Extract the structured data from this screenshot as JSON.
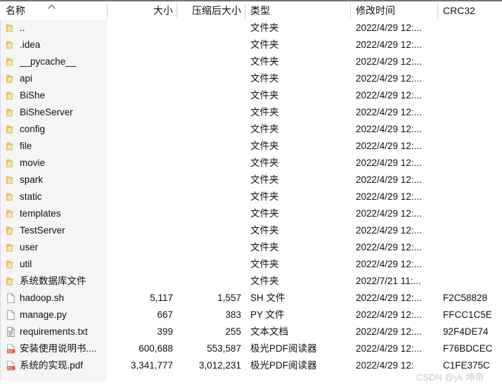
{
  "columns": {
    "name": "名称",
    "size": "大小",
    "packed_size": "压缩后大小",
    "type": "类型",
    "modified": "修改时间",
    "crc32": "CRC32"
  },
  "sort": {
    "column": "名称",
    "direction": "ascending",
    "icon": "chevron-up-icon"
  },
  "watermark": "CSDN @yk 坤帝",
  "accent_colors": {
    "folder": "#f5d07a",
    "folder_dark": "#e8b94d",
    "document": "#ffffff",
    "document_border": "#9a9a9a",
    "pdf_badge": "#e8453c",
    "panel_shade": "#f5f5f5",
    "divider": "#d5d5d5",
    "top_border": "#6b7280"
  },
  "rows": [
    {
      "icon": "folder-icon",
      "name": "..",
      "size": "",
      "packed": "",
      "type": "文件夹",
      "modified": "2022/4/29 12:...",
      "crc": ""
    },
    {
      "icon": "folder-icon",
      "name": ".idea",
      "size": "",
      "packed": "",
      "type": "文件夹",
      "modified": "2022/4/29 12:...",
      "crc": ""
    },
    {
      "icon": "folder-icon",
      "name": "__pycache__",
      "size": "",
      "packed": "",
      "type": "文件夹",
      "modified": "2022/4/29 12:...",
      "crc": ""
    },
    {
      "icon": "folder-icon",
      "name": "api",
      "size": "",
      "packed": "",
      "type": "文件夹",
      "modified": "2022/4/29 12:...",
      "crc": ""
    },
    {
      "icon": "folder-icon",
      "name": "BiShe",
      "size": "",
      "packed": "",
      "type": "文件夹",
      "modified": "2022/4/29 12:...",
      "crc": ""
    },
    {
      "icon": "folder-icon",
      "name": "BiSheServer",
      "size": "",
      "packed": "",
      "type": "文件夹",
      "modified": "2022/4/29 12:...",
      "crc": ""
    },
    {
      "icon": "folder-icon",
      "name": "config",
      "size": "",
      "packed": "",
      "type": "文件夹",
      "modified": "2022/4/29 12:...",
      "crc": ""
    },
    {
      "icon": "folder-icon",
      "name": "file",
      "size": "",
      "packed": "",
      "type": "文件夹",
      "modified": "2022/4/29 12:...",
      "crc": ""
    },
    {
      "icon": "folder-icon",
      "name": "movie",
      "size": "",
      "packed": "",
      "type": "文件夹",
      "modified": "2022/4/29 12:...",
      "crc": ""
    },
    {
      "icon": "folder-icon",
      "name": "spark",
      "size": "",
      "packed": "",
      "type": "文件夹",
      "modified": "2022/4/29 12:...",
      "crc": ""
    },
    {
      "icon": "folder-icon",
      "name": "static",
      "size": "",
      "packed": "",
      "type": "文件夹",
      "modified": "2022/4/29 12:...",
      "crc": ""
    },
    {
      "icon": "folder-icon",
      "name": "templates",
      "size": "",
      "packed": "",
      "type": "文件夹",
      "modified": "2022/4/29 12:...",
      "crc": ""
    },
    {
      "icon": "folder-icon",
      "name": "TestServer",
      "size": "",
      "packed": "",
      "type": "文件夹",
      "modified": "2022/4/29 12:...",
      "crc": ""
    },
    {
      "icon": "folder-icon",
      "name": "user",
      "size": "",
      "packed": "",
      "type": "文件夹",
      "modified": "2022/4/29 12:...",
      "crc": ""
    },
    {
      "icon": "folder-icon",
      "name": "util",
      "size": "",
      "packed": "",
      "type": "文件夹",
      "modified": "2022/4/29 12:...",
      "crc": ""
    },
    {
      "icon": "folder-icon",
      "name": "系统数据库文件",
      "size": "",
      "packed": "",
      "type": "文件夹",
      "modified": "2022/7/21 11:...",
      "crc": ""
    },
    {
      "icon": "file-blank-icon",
      "name": "hadoop.sh",
      "size": "5,117",
      "packed": "1,557",
      "type": "SH 文件",
      "modified": "2022/4/29 12:...",
      "crc": "F2C58828"
    },
    {
      "icon": "file-blank-icon",
      "name": "manage.py",
      "size": "667",
      "packed": "383",
      "type": "PY 文件",
      "modified": "2022/4/29 12:...",
      "crc": "FFCC1C5E"
    },
    {
      "icon": "file-text-icon",
      "name": "requirements.txt",
      "size": "399",
      "packed": "255",
      "type": "文本文档",
      "modified": "2022/4/29 12:...",
      "crc": "92F4DE74"
    },
    {
      "icon": "file-pdf-icon",
      "name": "安装使用说明书....",
      "size": "600,688",
      "packed": "553,587",
      "type": "极光PDF阅读器",
      "modified": "2022/4/29 12:...",
      "crc": "F76BDCEC"
    },
    {
      "icon": "file-pdf-icon",
      "name": "系统的实现.pdf",
      "size": "3,341,777",
      "packed": "3,012,231",
      "type": "极光PDF阅读器",
      "modified": "2022/4/29 12:",
      "crc": "C1FE375C"
    }
  ]
}
